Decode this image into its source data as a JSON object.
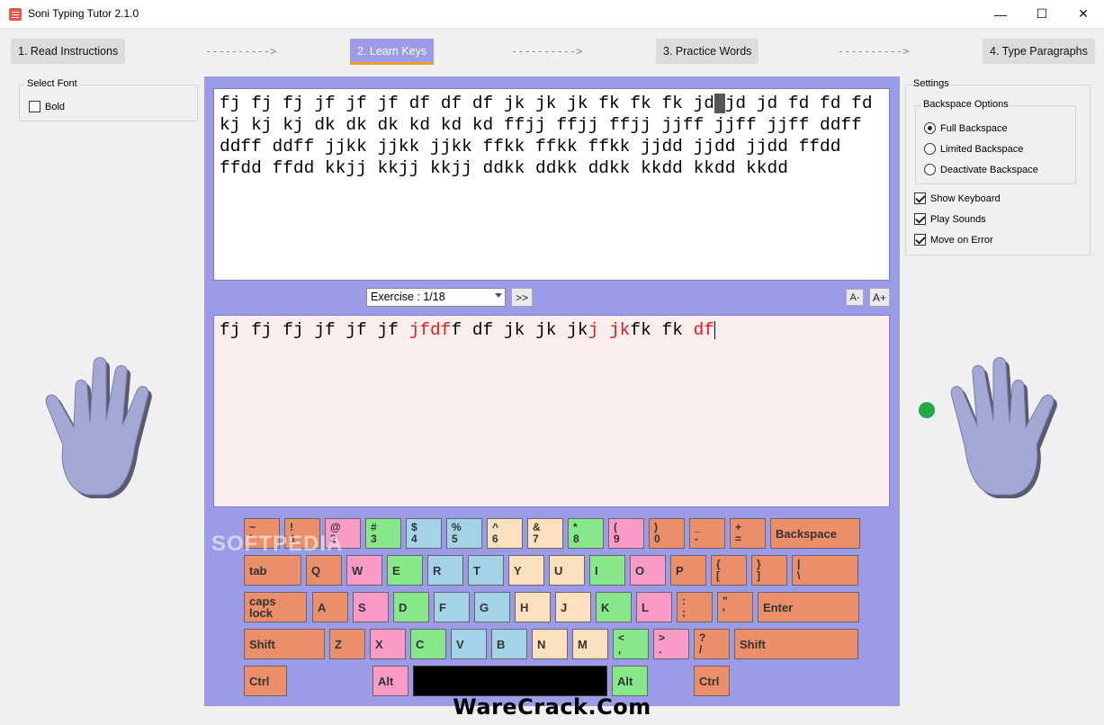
{
  "window": {
    "title": "Soni Typing Tutor 2.1.0"
  },
  "steps": [
    {
      "label": "1. Read Instructions"
    },
    {
      "label": "2. Learn Keys"
    },
    {
      "label": "3. Practice Words"
    },
    {
      "label": "4. Type Paragraphs"
    }
  ],
  "arrow_text": "---------->",
  "left_panel": {
    "legend": "Select Font",
    "bold_label": "Bold",
    "bold_checked": false
  },
  "settings": {
    "title": "Settings",
    "backspace_legend": "Backspace Options",
    "options": [
      {
        "label": "Full Backspace",
        "selected": true
      },
      {
        "label": "Limited Backspace",
        "selected": false
      },
      {
        "label": "Deactivate Backspace",
        "selected": false
      }
    ],
    "checks": [
      {
        "label": "Show Keyboard",
        "checked": true
      },
      {
        "label": "Play Sounds",
        "checked": true
      },
      {
        "label": "Move on Error",
        "checked": true
      }
    ]
  },
  "source_text": {
    "before_cursor": "fj fj fj jf jf jf df df df jk jk jk fk fk fk jd",
    "cursor_char": " ",
    "after_cursor": "jd jd fd fd fd kj kj kj dk dk dk kd kd kd ffjj ffjj ffjj jjff jjff jjff ddff ddff ddff jjkk jjkk jjkk ffkk ffkk ffkk jjdd jjdd jjdd ffdd ffdd ffdd kkjj kkjj kkjj ddkk ddkk ddkk kkdd kkdd kkdd"
  },
  "typed_text": [
    {
      "t": "fj fj fj jf jf jf ",
      "err": false
    },
    {
      "t": "jfdf",
      "err": true
    },
    {
      "t": "f df jk jk jk",
      "err": false
    },
    {
      "t": "j jk",
      "err": true
    },
    {
      "t": "fk fk ",
      "err": false
    },
    {
      "t": "df",
      "err": true
    }
  ],
  "exercise": {
    "label": "Exercise : 1/18",
    "next": ">>"
  },
  "font_size": {
    "decrease": "A-",
    "increase": "A+"
  },
  "keyboard": {
    "row1": [
      {
        "top": "~",
        "bot": "`",
        "c": "k-or"
      },
      {
        "top": "!",
        "bot": "1",
        "c": "k-or"
      },
      {
        "top": "@",
        "bot": "2",
        "c": "k-pk"
      },
      {
        "top": "#",
        "bot": "3",
        "c": "k-gr"
      },
      {
        "top": "$",
        "bot": "4",
        "c": "k-bl"
      },
      {
        "top": "%",
        "bot": "5",
        "c": "k-bl"
      },
      {
        "top": "^",
        "bot": "6",
        "c": "k-pe"
      },
      {
        "top": "&",
        "bot": "7",
        "c": "k-pe"
      },
      {
        "top": "*",
        "bot": "8",
        "c": "k-gr"
      },
      {
        "top": "(",
        "bot": "9",
        "c": "k-pk"
      },
      {
        "top": ")",
        "bot": "0",
        "c": "k-or"
      },
      {
        "top": "_",
        "bot": "-",
        "c": "k-or"
      },
      {
        "top": "+",
        "bot": "=",
        "c": "k-or"
      }
    ],
    "backspace": "Backspace",
    "tab": "tab",
    "row2": [
      {
        "l": "Q",
        "c": "k-or"
      },
      {
        "l": "W",
        "c": "k-pk"
      },
      {
        "l": "E",
        "c": "k-gr"
      },
      {
        "l": "R",
        "c": "k-bl"
      },
      {
        "l": "T",
        "c": "k-bl"
      },
      {
        "l": "Y",
        "c": "k-pe"
      },
      {
        "l": "U",
        "c": "k-pe"
      },
      {
        "l": "I",
        "c": "k-gr"
      },
      {
        "l": "O",
        "c": "k-pk"
      },
      {
        "l": "P",
        "c": "k-or"
      }
    ],
    "row2_sym": [
      {
        "top": "{",
        "bot": "[",
        "c": "k-or"
      },
      {
        "top": "}",
        "bot": "]",
        "c": "k-or"
      },
      {
        "top": "|",
        "bot": "\\",
        "c": "k-or"
      }
    ],
    "caps": "caps lock",
    "row3": [
      {
        "l": "A",
        "c": "k-or"
      },
      {
        "l": "S",
        "c": "k-pk"
      },
      {
        "l": "D",
        "c": "k-gr"
      },
      {
        "l": "F",
        "c": "k-bl"
      },
      {
        "l": "G",
        "c": "k-bl"
      },
      {
        "l": "H",
        "c": "k-pe"
      },
      {
        "l": "J",
        "c": "k-pe"
      },
      {
        "l": "K",
        "c": "k-gr"
      },
      {
        "l": "L",
        "c": "k-pk"
      }
    ],
    "row3_sym": [
      {
        "top": ":",
        "bot": ";",
        "c": "k-or"
      },
      {
        "top": "\"",
        "bot": "'",
        "c": "k-or"
      }
    ],
    "enter": "Enter",
    "shift": "Shift",
    "row4": [
      {
        "l": "Z",
        "c": "k-or"
      },
      {
        "l": "X",
        "c": "k-pk"
      },
      {
        "l": "C",
        "c": "k-gr"
      },
      {
        "l": "V",
        "c": "k-bl"
      },
      {
        "l": "B",
        "c": "k-bl"
      },
      {
        "l": "N",
        "c": "k-pe"
      },
      {
        "l": "M",
        "c": "k-pe"
      }
    ],
    "row4_sym": [
      {
        "top": "<",
        "bot": ",",
        "c": "k-gr"
      },
      {
        "top": ">",
        "bot": ".",
        "c": "k-pk"
      },
      {
        "top": "?",
        "bot": "/",
        "c": "k-or"
      }
    ],
    "ctrl": "Ctrl",
    "alt": "Alt"
  },
  "watermark": "SOFTPEDIA",
  "footer": "WareCrack.Com"
}
